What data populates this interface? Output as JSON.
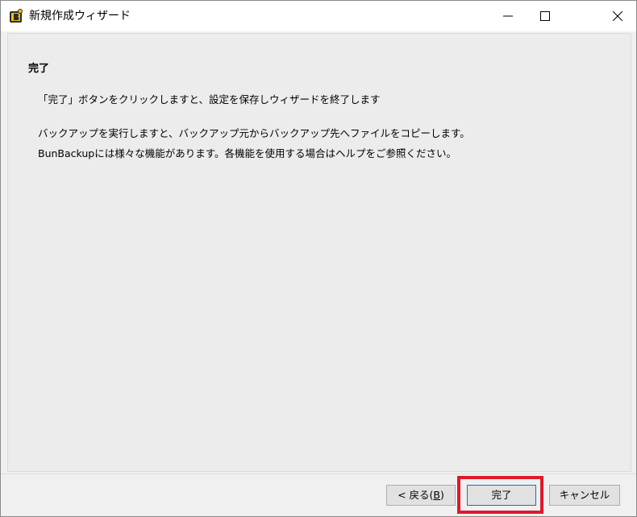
{
  "window": {
    "title": "新規作成ウィザード",
    "icon": "bunbackup-app-icon"
  },
  "titlebar_buttons": {
    "minimize_icon": "minimize-icon",
    "maximize_icon": "maximize-icon",
    "close_icon": "close-icon"
  },
  "content": {
    "heading": "完了",
    "line1": "「完了」ボタンをクリックしますと、設定を保存しウィザードを終了します",
    "line2": "バックアップを実行しますと、バックアップ元からバックアップ先へファイルをコピーします。",
    "line3": "BunBackupには様々な機能があります。各機能を使用する場合はヘルプをご参照ください。"
  },
  "buttons": {
    "back_prefix": "< 戻る(",
    "back_mnemonic": "B",
    "back_suffix": ")",
    "finish": "完了",
    "cancel": "キャンセル"
  },
  "colors": {
    "highlight": "#e0192a",
    "default_button_border": "#0078d7",
    "window_bg": "#f0f0f0"
  }
}
